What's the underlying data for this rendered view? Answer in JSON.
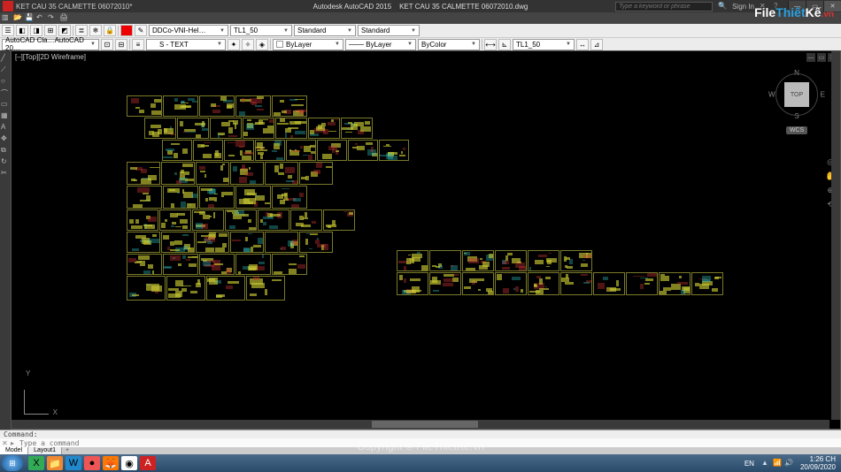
{
  "app": {
    "name": "Autodesk AutoCAD 2015",
    "document": "KET CAU 35 CALMETTE 06072010.dwg",
    "tab_name": "KET CAU 35 CALMETTE 06072010*",
    "search_placeholder": "Type a keyword or phrase",
    "signin": "Sign In"
  },
  "ribbon": {
    "layer_dd": "AutoCAD Cla…AutoCAD 20…",
    "stext": "S - TEXT",
    "textstyle": "DDCo-VNI-Hel…",
    "dimstyle": "TL1_50",
    "tablestyle": "Standard",
    "mlstyle": "Standard",
    "bylayer1": "ByLayer",
    "bylayer2": "ByLayer",
    "bycolor": "ByColor",
    "tl150b": "TL1_50"
  },
  "viewport": {
    "label": "[–][Top][2D Wireframe]",
    "cube_face": "TOP",
    "n": "N",
    "s": "S",
    "e": "E",
    "w": "W",
    "wcs": "WCS"
  },
  "ucs": {
    "x": "X",
    "y": "Y"
  },
  "command": {
    "history": "Command:",
    "placeholder": "Type a command"
  },
  "layout_tabs": {
    "model": "Model",
    "layout1": "Layout1"
  },
  "taskbar": {
    "lang": "EN",
    "time": "1:26 CH",
    "date": "20/09/2020"
  },
  "watermark": "Copyright © FileThietKe.vn",
  "logo": {
    "p1": "File",
    "p2": "Thiết",
    "p3": "Kế",
    "p4": ".vn"
  }
}
